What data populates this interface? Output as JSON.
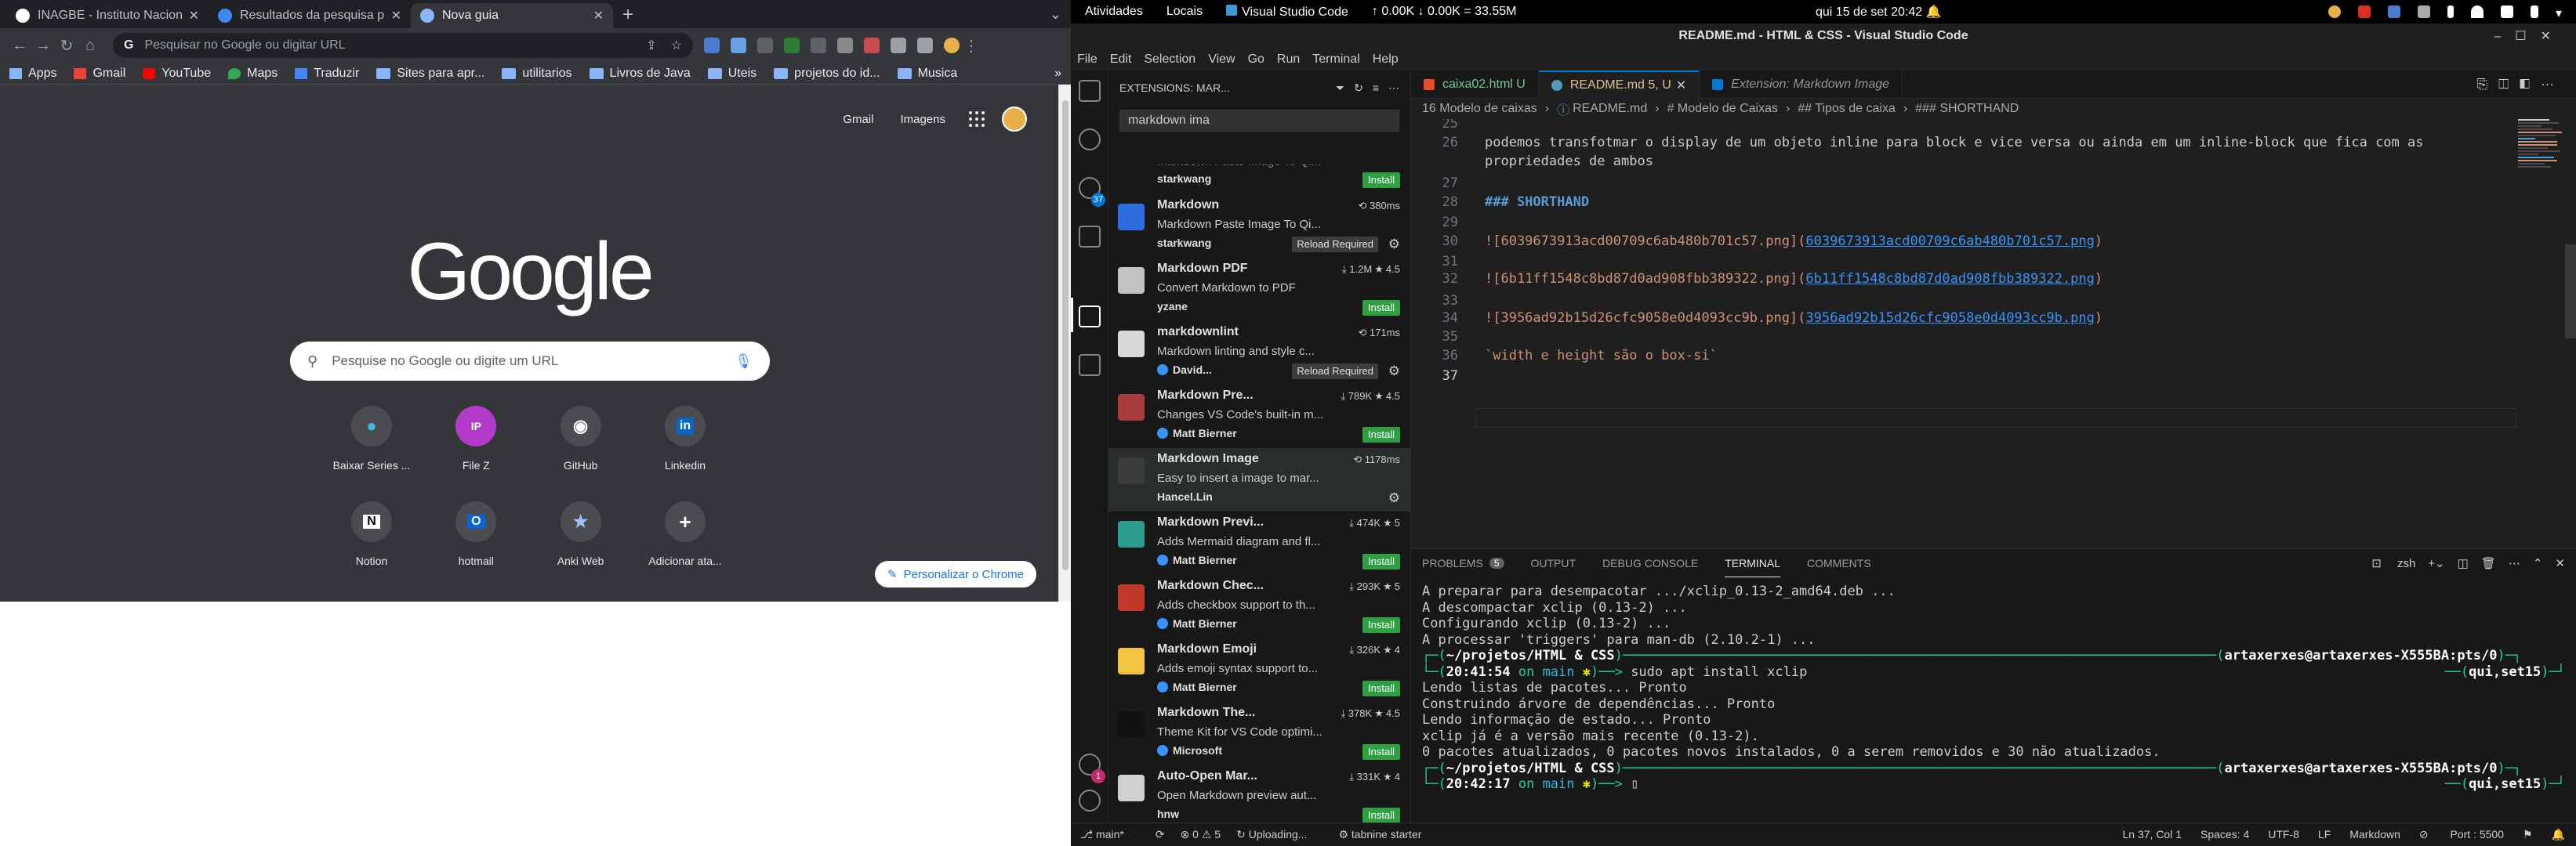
{
  "chrome": {
    "tabs": [
      {
        "title": "INAGBE - Instituto Nacion",
        "color": "#ffffff"
      },
      {
        "title": "Resultados da pesquisa p",
        "color": "#4285f4"
      },
      {
        "title": "Nova guia",
        "color": "#8ab4f8"
      }
    ],
    "omnibox_placeholder": "Pesquisar no Google ou digitar URL",
    "bookmarks": [
      {
        "label": "Apps",
        "icon": "apps-icon"
      },
      {
        "label": "Gmail",
        "icon": "gmail-icon"
      },
      {
        "label": "YouTube",
        "icon": "youtube-icon"
      },
      {
        "label": "Maps",
        "icon": "maps-icon"
      },
      {
        "label": "Traduzir",
        "icon": "translate-icon"
      },
      {
        "label": "Sites para apr...",
        "icon": "folder-icon"
      },
      {
        "label": "utilitarios",
        "icon": "folder-icon"
      },
      {
        "label": "Livros de Java",
        "icon": "folder-icon"
      },
      {
        "label": "Uteis",
        "icon": "folder-icon"
      },
      {
        "label": "projetos do id...",
        "icon": "folder-icon"
      },
      {
        "label": "Musica",
        "icon": "folder-icon"
      }
    ],
    "ntp": {
      "gmail": "Gmail",
      "images": "Imagens",
      "logo": "Google",
      "search_placeholder": "Pesquise no Google ou digite um URL",
      "shortcuts_row1": [
        {
          "label": "Baixar Series ...",
          "glyph": "●",
          "color": "#3dbbe6"
        },
        {
          "label": "File Z",
          "glyph": "IP",
          "color": "#b23cc9"
        },
        {
          "label": "GitHub",
          "glyph": "◉",
          "color": "#4a4c50"
        },
        {
          "label": "Linkedin",
          "glyph": "in",
          "color": "#0a66c2"
        }
      ],
      "shortcuts_row2": [
        {
          "label": "Notion",
          "glyph": "N",
          "color": "#4a4c50"
        },
        {
          "label": "hotmail",
          "glyph": "O",
          "color": "#0a64d8"
        },
        {
          "label": "Anki Web",
          "glyph": "★",
          "color": "#4a4c50"
        },
        {
          "label": "Adicionar ata...",
          "glyph": "+",
          "color": "#4a4c50"
        }
      ],
      "customize": "Personalizar o Chrome"
    }
  },
  "topbar": {
    "activities": "Atividades",
    "places": "Locais",
    "app": "Visual Studio Code",
    "netspeed": "↑ 0.00K ↓ 0.00K = 33.55M",
    "clock": "qui 15 de set  20:42"
  },
  "vscode": {
    "title": "README.md - HTML & CSS - Visual Studio Code",
    "menu": [
      "File",
      "Edit",
      "Selection",
      "View",
      "Go",
      "Run",
      "Terminal",
      "Help"
    ],
    "badges": {
      "scm": "37",
      "accounts": "1"
    },
    "sidebar": {
      "header": "EXTENSIONS: MAR...",
      "search_value": "markdown ima",
      "extensions": [
        {
          "name": "",
          "meta": "",
          "desc": "Markdown Paste Image To Qi...",
          "publisher": "starkwang",
          "verified": false,
          "action": "Install",
          "reload": "",
          "color": "#555"
        },
        {
          "name": "Markdown",
          "meta": "⟲ 380ms",
          "desc": "Markdown Paste Image To Qi...",
          "publisher": "starkwang",
          "verified": false,
          "action": "gear",
          "reload": "Reload Required",
          "color": "#2d6cdf"
        },
        {
          "name": "Markdown PDF",
          "meta": "⤓ 1.2M ★ 4.5",
          "desc": "Convert Markdown to PDF",
          "publisher": "yzane",
          "verified": false,
          "action": "Install",
          "reload": "",
          "color": "#c2c2c2"
        },
        {
          "name": "markdownlint",
          "meta": "⟲ 171ms",
          "desc": "Markdown linting and style c...",
          "publisher": "David...",
          "verified": true,
          "action": "gear",
          "reload": "Reload Required",
          "color": "#d8d8d8"
        },
        {
          "name": "Markdown Pre...",
          "meta": "⤓ 789K ★ 4.5",
          "desc": "Changes VS Code's built-in m...",
          "publisher": "Matt Bierner",
          "verified": true,
          "action": "Install",
          "reload": "",
          "color": "#a63c3c"
        },
        {
          "name": "Markdown Image",
          "meta": "⟲ 1178ms",
          "desc": "Easy to insert a image to mar...",
          "publisher": "Hancel.Lin",
          "verified": false,
          "action": "gear",
          "reload": "",
          "color": "#3c3c3c"
        },
        {
          "name": "Markdown Previ...",
          "meta": "⤓ 474K ★ 5",
          "desc": "Adds Mermaid diagram and fl...",
          "publisher": "Matt Bierner",
          "verified": true,
          "action": "Install",
          "reload": "",
          "color": "#2a9d8f"
        },
        {
          "name": "Markdown Chec...",
          "meta": "⤓ 293K ★ 5",
          "desc": "Adds checkbox support to th...",
          "publisher": "Matt Bierner",
          "verified": true,
          "action": "Install",
          "reload": "",
          "color": "#c0392b"
        },
        {
          "name": "Markdown Emoji",
          "meta": "⤓ 326K ★ 4",
          "desc": "Adds emoji syntax support to...",
          "publisher": "Matt Bierner",
          "verified": true,
          "action": "Install",
          "reload": "",
          "color": "#f4c542"
        },
        {
          "name": "Markdown The...",
          "meta": "⤓ 378K ★ 4.5",
          "desc": "Theme Kit for VS Code optimi...",
          "publisher": "Microsoft",
          "verified": true,
          "action": "Install",
          "reload": "",
          "color": "#111"
        },
        {
          "name": "Auto-Open Mar...",
          "meta": "⤓ 331K ★ 4",
          "desc": "Open Markdown preview aut...",
          "publisher": "hnw",
          "verified": false,
          "action": "Install",
          "reload": "",
          "color": "#d0d0d0"
        }
      ]
    },
    "tabs": [
      {
        "label": "caixa02.html U",
        "active": false,
        "preview": false,
        "icon_color": "#e44d26"
      },
      {
        "label": "README.md 5, U",
        "active": true,
        "preview": false,
        "icon_color": "#519aba"
      },
      {
        "label": "Extension: Markdown Image",
        "active": false,
        "preview": true,
        "icon_color": "#0078d4"
      }
    ],
    "breadcrumb": [
      "16 Modelo de caixas",
      "›",
      "README.md",
      "›",
      "# Modelo de Caixas",
      "›",
      "## Tipos de caixa",
      "›",
      "### SHORTHAND"
    ],
    "lines": [
      {
        "n": "25",
        "text": ""
      },
      {
        "n": "26",
        "text": "podemos transfotmar o display de um objeto inline para block e vice versa ou ainda em um inline-block que fica com as"
      },
      {
        "n": "",
        "text": "propriedades de ambos"
      },
      {
        "n": "27",
        "text": ""
      },
      {
        "n": "28",
        "text": "### SHORTHAND"
      },
      {
        "n": "29",
        "text": ""
      },
      {
        "n": "30",
        "text": "![6039673913acd00709c6ab480b701c57.png](6039673913acd00709c6ab480b701c57.png)"
      },
      {
        "n": "31",
        "text": ""
      },
      {
        "n": "32",
        "text": "![6b11ff1548c8bd87d0ad908fbb389322.png](6b11ff1548c8bd87d0ad908fbb389322.png)"
      },
      {
        "n": "33",
        "text": ""
      },
      {
        "n": "34",
        "text": "![3956ad92b15d26cfc9058e0d4093cc9b.png](3956ad92b15d26cfc9058e0d4093cc9b.png)"
      },
      {
        "n": "35",
        "text": ""
      },
      {
        "n": "36",
        "text": "`width e height são o box-si`"
      },
      {
        "n": "37",
        "text": ""
      }
    ],
    "panel": {
      "tabs": [
        "PROBLEMS",
        "OUTPUT",
        "DEBUG CONSOLE",
        "TERMINAL",
        "COMMENTS"
      ],
      "problems_count": "5",
      "shell": "zsh",
      "terminal": [
        "A preparar para desempacotar .../xclip_0.13-2_amd64.deb ...",
        "A descompactar xclip (0.13-2) ...",
        "Configurando xclip (0.13-2) ...",
        "A processar 'triggers' para man-db (2.10.2-1) ..."
      ],
      "prompt1_path": "~/projetos/HTML & CSS",
      "prompt1_user": "artaxerxes@artaxerxes-X555BA:pts/0",
      "prompt1_time": "20:41:54",
      "branch": "main",
      "command": "sudo apt install xclip",
      "date_tag": "qui,set15",
      "output": [
        "Lendo listas de pacotes... Pronto",
        "Construindo árvore de dependências... Pronto",
        "Lendo informação de estado... Pronto",
        "xclip já é a versão mais recente (0.13-2).",
        "0 pacotes atualizados, 0 pacotes novos instalados, 0 a serem removidos e 30 não atualizados."
      ],
      "prompt2_time": "20:42:17"
    },
    "status": {
      "branch": "main*",
      "problems": "⊗ 0 ⚠ 5",
      "uploading": "Uploading...",
      "tabnine": "tabnine starter",
      "position": "Ln 37, Col 1",
      "spaces": "Spaces: 4",
      "encoding": "UTF-8",
      "eol": "LF",
      "language": "Markdown",
      "port": "Port : 5500"
    }
  }
}
